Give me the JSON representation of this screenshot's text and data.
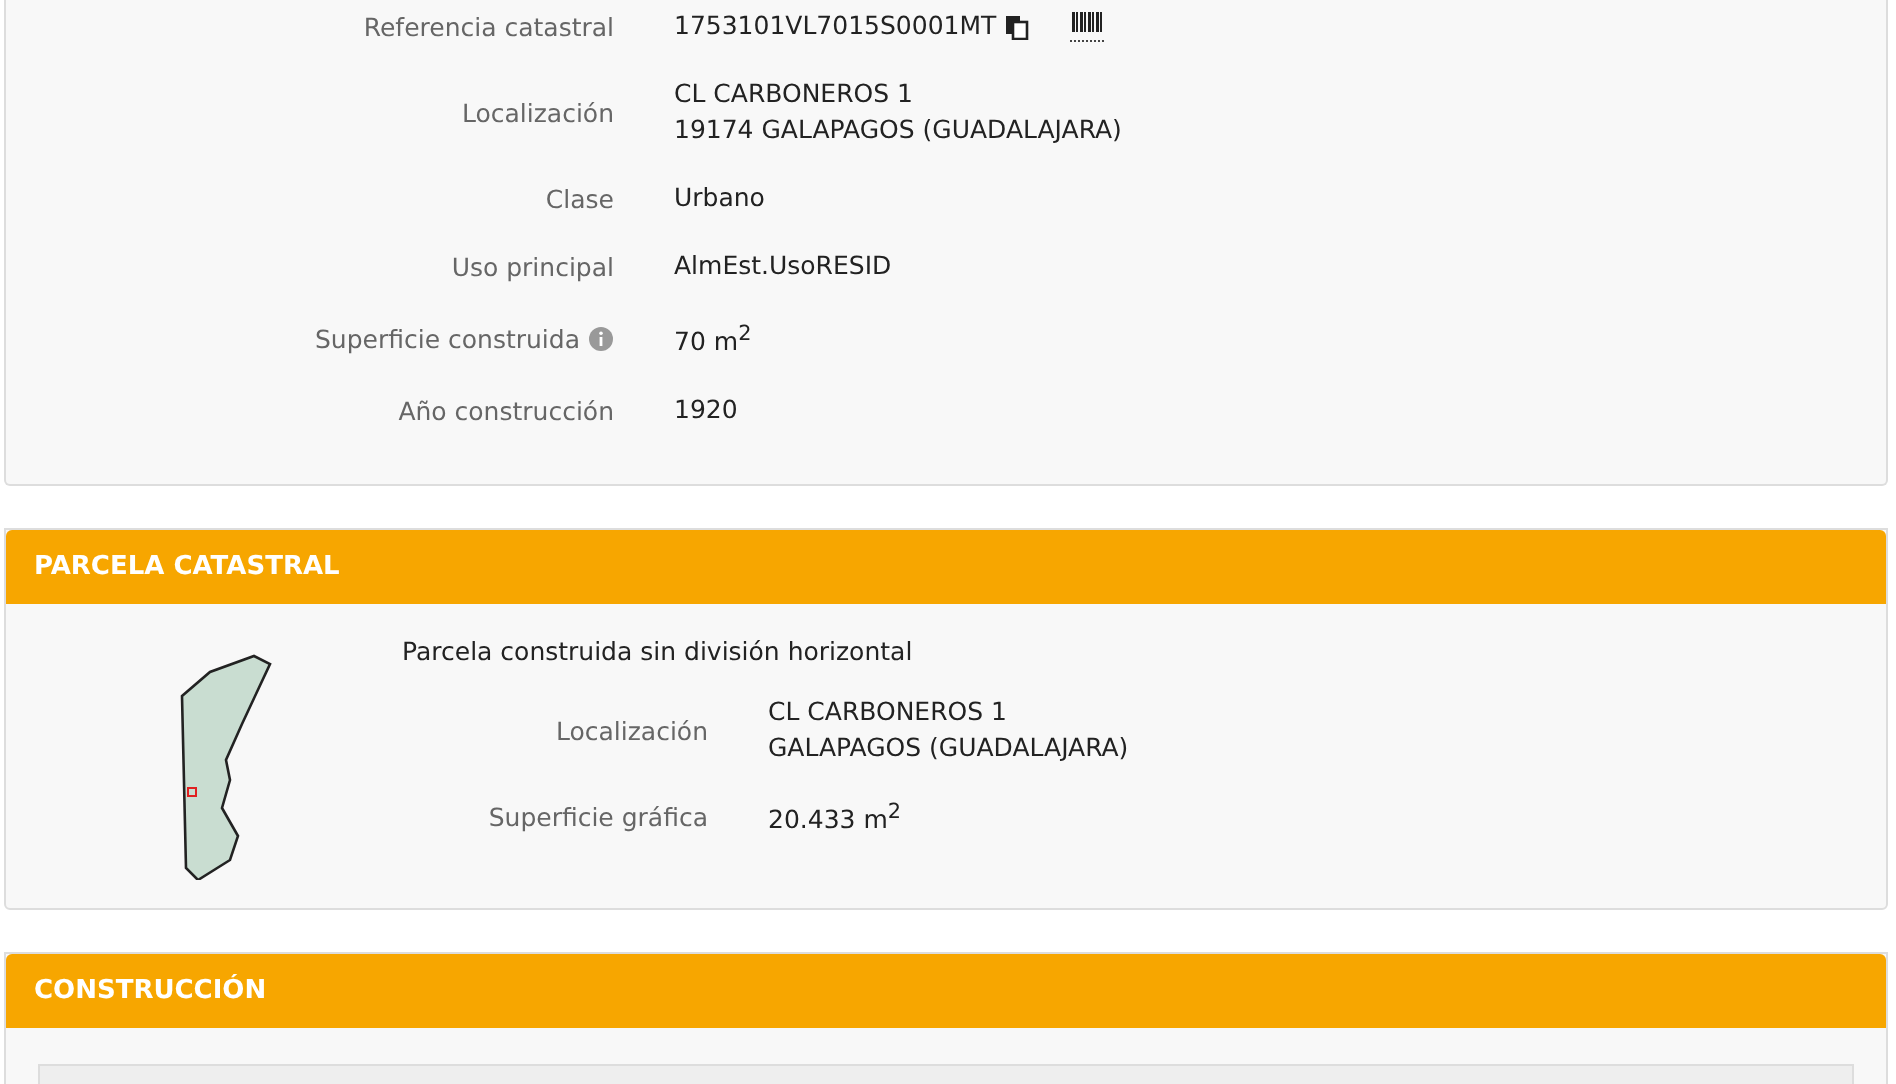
{
  "inmueble": {
    "rows": [
      {
        "kind": "ref",
        "label": "Referencia catastral",
        "value": "1753101VL7015S0001MT"
      },
      {
        "kind": "text",
        "label": "Localización",
        "lines": [
          "CL CARBONEROS 1",
          "19174 GALAPAGOS (GUADALAJARA)"
        ]
      },
      {
        "kind": "text",
        "label": "Clase",
        "lines": [
          "Urbano"
        ]
      },
      {
        "kind": "text",
        "label": "Uso principal",
        "lines": [
          "AlmEst.UsoRESID"
        ]
      },
      {
        "kind": "info",
        "label": "Superficie construida",
        "lines": [
          "70 m$^{2}$"
        ]
      },
      {
        "kind": "text",
        "label": "Año construcción",
        "lines": [
          "1920"
        ]
      }
    ]
  },
  "parcela": {
    "title": "PARCELA CATASTRAL",
    "description": "Parcela construida sin división horizontal",
    "rows": [
      {
        "label": "Localización",
        "lines": [
          "CL CARBONEROS 1",
          "GALAPAGOS (GUADALAJARA)"
        ]
      },
      {
        "label": "Superficie gráfica",
        "lines": [
          "20.433 m$^{2}$"
        ]
      }
    ]
  },
  "construccion": {
    "title": "CONSTRUCCIÓN"
  }
}
